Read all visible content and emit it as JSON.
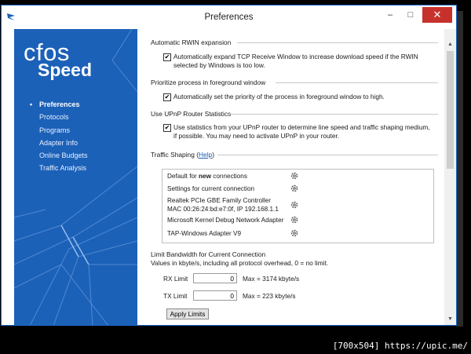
{
  "window": {
    "title": "Preferences"
  },
  "titlebar": {
    "minimize": "–",
    "maximize": "□",
    "close": "✕"
  },
  "logo": {
    "line1": "cfos",
    "line2": "Speed"
  },
  "nav": [
    {
      "label": "Preferences",
      "active": true
    },
    {
      "label": "Protocols"
    },
    {
      "label": "Programs"
    },
    {
      "label": "Adapter Info"
    },
    {
      "label": "Online Budgets"
    },
    {
      "label": "Traffic Analysis"
    }
  ],
  "sections": {
    "rwin": {
      "heading": "Automatic RWIN expansion",
      "option": "Automatically expand TCP Receive Window to increase download speed if the RWIN selected by Windows is too low.",
      "checked": true
    },
    "priority": {
      "heading": "Prioritize process in foreground window",
      "option": "Automatically set the priority of the process in foreground window to high.",
      "checked": true
    },
    "upnp": {
      "heading": "Use UPnP Router Statistics",
      "option": "Use statistics from your UPnP router to determine line speed and traffic shaping medium, if possible. You may need to activate UPnP in your router.",
      "checked": true
    },
    "traffic_shaping": {
      "heading": "Traffic Shaping (",
      "help_link": "Help",
      "heading_end": ")",
      "rows": [
        {
          "prefix": "Default for ",
          "bold": "new",
          "suffix": " connections"
        },
        {
          "line1": "Settings for current connection"
        },
        {
          "line1": "Realtek PCIe GBE Family Controller",
          "line2": "MAC 00:26:24:bd:e7:0f, IP 192.168.1.1"
        },
        {
          "line1": "Microsoft Kernel Debug Network Adapter"
        },
        {
          "line1": "TAP-Windows Adapter V9"
        }
      ],
      "gear_icon": "gear-icon"
    },
    "limit": {
      "heading": "Limit Bandwidth for Current Connection",
      "description": "Values in kbyte/s, including all protocol overhead, 0 = no limit.",
      "rx_label": "RX Limit",
      "rx_value": "0",
      "rx_max": "Max = 3174 kbyte/s",
      "tx_label": "TX Limit",
      "tx_value": "0",
      "tx_max": "Max = 223 kbyte/s",
      "apply_label": "Apply Limits"
    }
  },
  "footer": {
    "text": "[700x504] https://upic.me/"
  },
  "colors": {
    "sidebar": "#1c61b8",
    "close": "#c7312c",
    "link": "#1a5fb4"
  }
}
